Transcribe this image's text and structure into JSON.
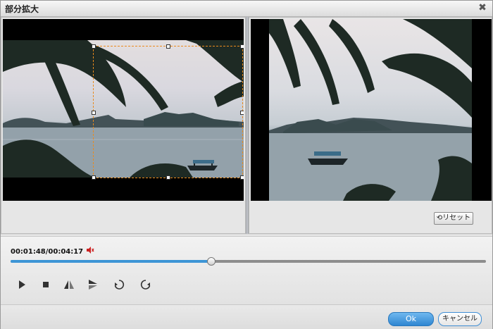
{
  "window": {
    "title": "部分拡大",
    "close_icon": "close-icon"
  },
  "preview": {
    "reset_label": "リセット",
    "reset_icon": "reset-icon"
  },
  "playback": {
    "time_text": "00:01:48/00:04:17",
    "progress": 0.42,
    "volume_icon": "speaker-muted-icon"
  },
  "controls": [
    {
      "name": "play-button",
      "icon": "play-icon"
    },
    {
      "name": "stop-button",
      "icon": "stop-icon"
    },
    {
      "name": "flip-horizontal-button",
      "icon": "flip-horizontal-icon"
    },
    {
      "name": "flip-vertical-button",
      "icon": "flip-vertical-icon"
    },
    {
      "name": "rotate-left-90-button",
      "icon": "rotate-left-icon"
    },
    {
      "name": "rotate-right-90-button",
      "icon": "rotate-right-icon"
    }
  ],
  "footer": {
    "ok_label": "Ok",
    "cancel_label": "キャンセル"
  },
  "colors": {
    "accent": "#3d95d6",
    "crop_border": "#e98a1d"
  }
}
